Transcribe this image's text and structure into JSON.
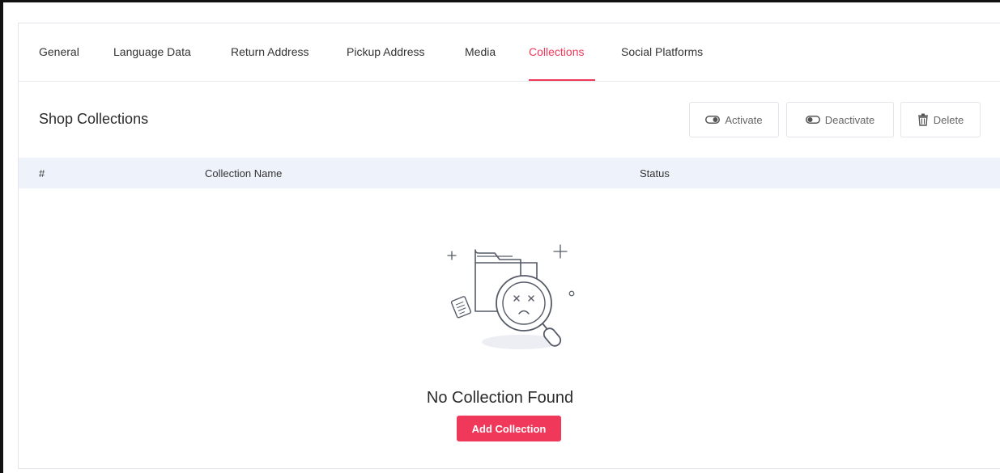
{
  "tabs": [
    {
      "label": "General"
    },
    {
      "label": "Language Data"
    },
    {
      "label": "Return Address"
    },
    {
      "label": "Pickup Address"
    },
    {
      "label": "Media"
    },
    {
      "label": "Collections",
      "active": true
    },
    {
      "label": "Social Platforms"
    }
  ],
  "section": {
    "title": "Shop Collections"
  },
  "actions": {
    "activate": "Activate",
    "deactivate": "Deactivate",
    "delete": "Delete"
  },
  "table": {
    "columns": [
      "#",
      "Collection Name",
      "Status"
    ]
  },
  "empty_state": {
    "message": "No Collection Found",
    "button": "Add Collection"
  },
  "colors": {
    "accent": "#f0385a",
    "table_header_bg": "#eef3fb"
  },
  "icons": {
    "activate": "toggle-on-icon",
    "deactivate": "toggle-off-icon",
    "delete": "trash-icon",
    "empty": "folder-search-sad-icon"
  }
}
